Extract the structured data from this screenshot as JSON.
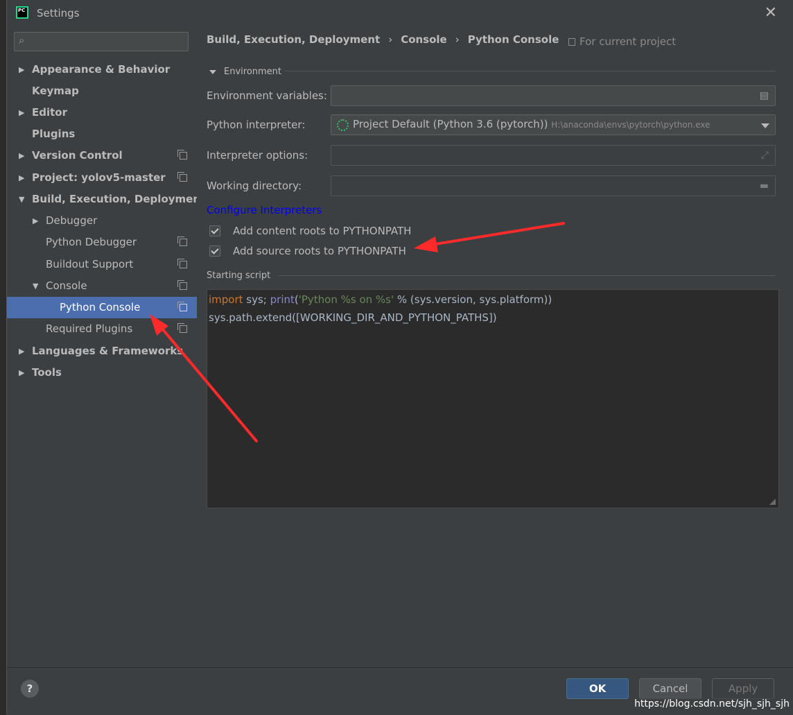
{
  "window": {
    "title": "Settings",
    "app_icon": "pycharm-logo",
    "app_icon_text": "PC"
  },
  "sidebar": {
    "search_placeholder": "",
    "items": [
      {
        "label": "Appearance & Behavior",
        "expandable": true
      },
      {
        "label": "Keymap"
      },
      {
        "label": "Editor",
        "expandable": true
      },
      {
        "label": "Plugins"
      },
      {
        "label": "Version Control",
        "expandable": true
      },
      {
        "label": "Project: yolov5-master",
        "expandable": true
      },
      {
        "label": "Build, Execution, Deployment",
        "expanded": true
      },
      {
        "label": "Debugger",
        "expandable": true
      },
      {
        "label": "Python Debugger"
      },
      {
        "label": "Buildout Support"
      },
      {
        "label": "Console",
        "expanded": true
      },
      {
        "label": "Python Console",
        "selected": true
      },
      {
        "label": "Required Plugins"
      },
      {
        "label": "Languages & Frameworks",
        "expandable": true
      },
      {
        "label": "Tools",
        "expandable": true
      }
    ]
  },
  "breadcrumb": [
    "Build, Execution, Deployment",
    "Console",
    "Python Console"
  ],
  "scope_label": "For current project",
  "environment": {
    "section_title": "Environment",
    "env_vars_label": "Environment variables:",
    "env_vars_value": "",
    "interpreter_label": "Python interpreter:",
    "interpreter_value": "Project Default (Python 3.6 (pytorch))",
    "interpreter_path": "H:\\anaconda\\envs\\pytorch\\python.exe",
    "interp_options_label": "Interpreter options:",
    "interp_options_value": "",
    "working_dir_label": "Working directory:",
    "working_dir_value": "",
    "configure_link": "Configure Interpreters",
    "checkbox_content_roots": {
      "label": "Add content roots to PYTHONPATH",
      "checked": true
    },
    "checkbox_source_roots": {
      "label": "Add source roots to PYTHONPATH",
      "checked": true
    }
  },
  "starting_script": {
    "section_title": "Starting script",
    "line1": {
      "kw": "import",
      "a": " sys; ",
      "fn": "print",
      "b": "(",
      "str": "'Python %s on %s'",
      "c": " % (sys.version, sys.platform))"
    },
    "line2": "sys.path.extend([WORKING_DIR_AND_PYTHON_PATHS])"
  },
  "buttons": {
    "help": "?",
    "ok": "OK",
    "cancel": "Cancel",
    "apply": "Apply"
  },
  "watermark": "https://blog.csdn.net/sjh_sjh_sjh"
}
